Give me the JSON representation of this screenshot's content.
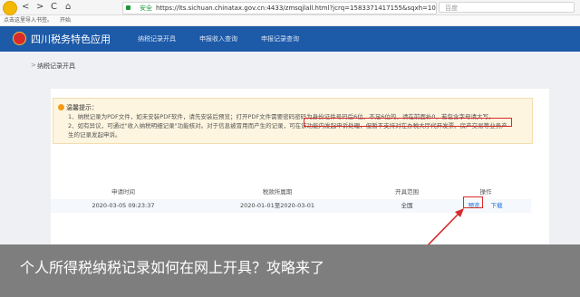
{
  "browser": {
    "nav": {
      "back": "<",
      "forward": ">",
      "reload": "C",
      "home": "⌂"
    },
    "secure_label": "安全",
    "url": "https://lts.sichuan.chinatax.gov.cn:4433/zmsqjlall.html?jcrq=1583371417155&sqxh=1081...",
    "search_placeholder": "百度",
    "bookmarks": [
      "点击这里导入书签。",
      "开始"
    ]
  },
  "app": {
    "title": "四川税务特色应用",
    "menu": [
      "纳税记录开具",
      "申报收入查询",
      "申报记录查询"
    ]
  },
  "breadcrumb": {
    "arrow": ">",
    "label": "纳税记录开具"
  },
  "notice": {
    "title": "温馨提示：",
    "line1_before": "1、纳税记录为PDF文件，如未安装PDF软件，请先安装后预览；打开PDF文件需要密码",
    "line1_highlight": "密码为身份证件号码后6位，不足6位的，请在前面补0，若包含字母请大写。",
    "line2": "2、如有异议，可通过\"收入纳税明细记录\"功能核对。对于信息被冒用而产生的记录，可在该功能内发起申诉处理，但暂不支持对在办税大厅代开发票、房产交易等业务产",
    "line3": "生的记录发起申诉。"
  },
  "table": {
    "headers": [
      "申请时间",
      "税款所属期",
      "开具范围",
      "操作"
    ],
    "rows": [
      {
        "time": "2020-03-05 09:23:37",
        "period": "2020-01-01至2020-03-01",
        "scope": "全国",
        "preview": "预览",
        "download": "下载"
      }
    ]
  },
  "caption": "个人所得税纳税记录如何在网上开具？攻略来了",
  "colors": {
    "appbar": "#1d5aa8",
    "highlight_border": "#d92b2b",
    "link": "#1d6ed8"
  }
}
